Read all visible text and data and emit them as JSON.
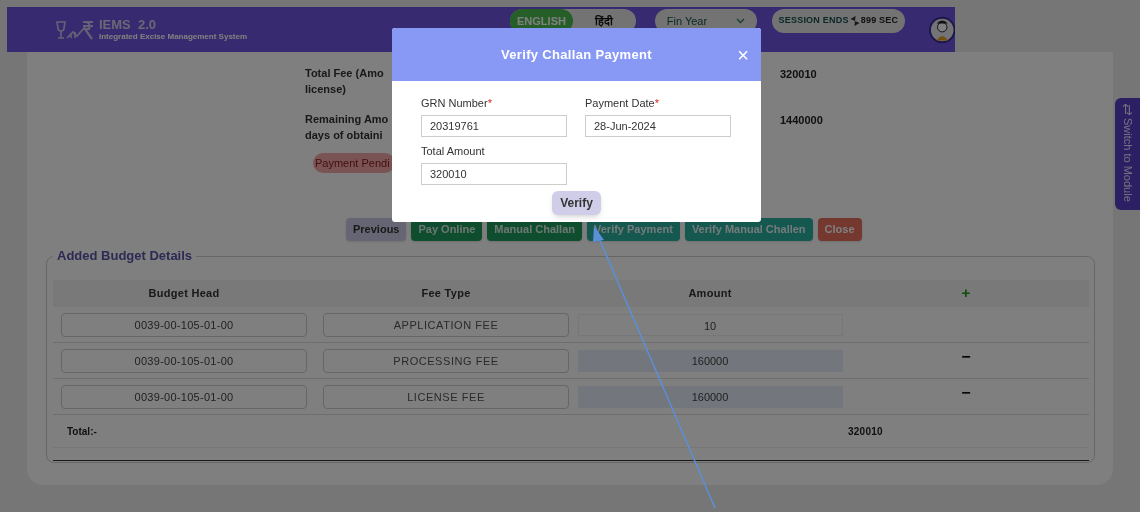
{
  "header": {
    "logo_title": "IEMS  2.0",
    "logo_subtitle": "Integrated Excise Management System",
    "languages": [
      {
        "label": "ENGLISH",
        "selected": true
      },
      {
        "label": "हिंदी",
        "selected": false
      }
    ],
    "fin_year": {
      "placeholder": "Fin Year"
    },
    "session": {
      "label": "SESSION ENDS",
      "countdown": "899 SEC"
    }
  },
  "fee_info": [
    {
      "label_lines": [
        "Total Fee (Amo",
        "license)"
      ],
      "value": "320010"
    },
    {
      "label_lines": [
        "Remaining Amo",
        "days of obtaini"
      ],
      "value": "1440000"
    }
  ],
  "payment_status": "Payment Pendi",
  "actions": [
    {
      "label": "Previous",
      "kind": "neutral"
    },
    {
      "label": "Pay Online",
      "kind": "primary"
    },
    {
      "label": "Manual Challan",
      "kind": "primary"
    },
    {
      "label": "Verify Payment",
      "kind": "secondary"
    },
    {
      "label": "Verify Manual Challen",
      "kind": "secondary"
    },
    {
      "label": "Close",
      "kind": "danger"
    }
  ],
  "budget": {
    "title": "Added Budget Details",
    "columns": [
      "Budget Head",
      "Fee Type",
      "Amount",
      "+"
    ],
    "rows": [
      {
        "budget_head": "0039-00-105-01-00",
        "fee_type": "APPLICATION FEE",
        "amount": "10",
        "kind": "fixed"
      },
      {
        "budget_head": "0039-00-105-01-00",
        "fee_type": "PROCESSING FEE",
        "amount": "160000",
        "kind": "added",
        "remove": "−"
      },
      {
        "budget_head": "0039-00-105-01-00",
        "fee_type": "LICENSE FEE",
        "amount": "160000",
        "kind": "added",
        "remove": "−"
      }
    ],
    "total_label": "Total:-",
    "total_value": "320010"
  },
  "side_tab": {
    "icon": "⇅",
    "label": "Switch to Module"
  },
  "modal": {
    "title": "Verify Challan Payment",
    "close": "×",
    "fields": [
      {
        "label": "GRN Number",
        "required": true,
        "value": "20319761"
      },
      {
        "label": "Payment Date",
        "required": true,
        "value": "28-Jun-2024"
      },
      {
        "label": "Total Amount",
        "required": false,
        "value": "320010"
      }
    ],
    "submit": "Verify",
    "required_mark": "*"
  }
}
